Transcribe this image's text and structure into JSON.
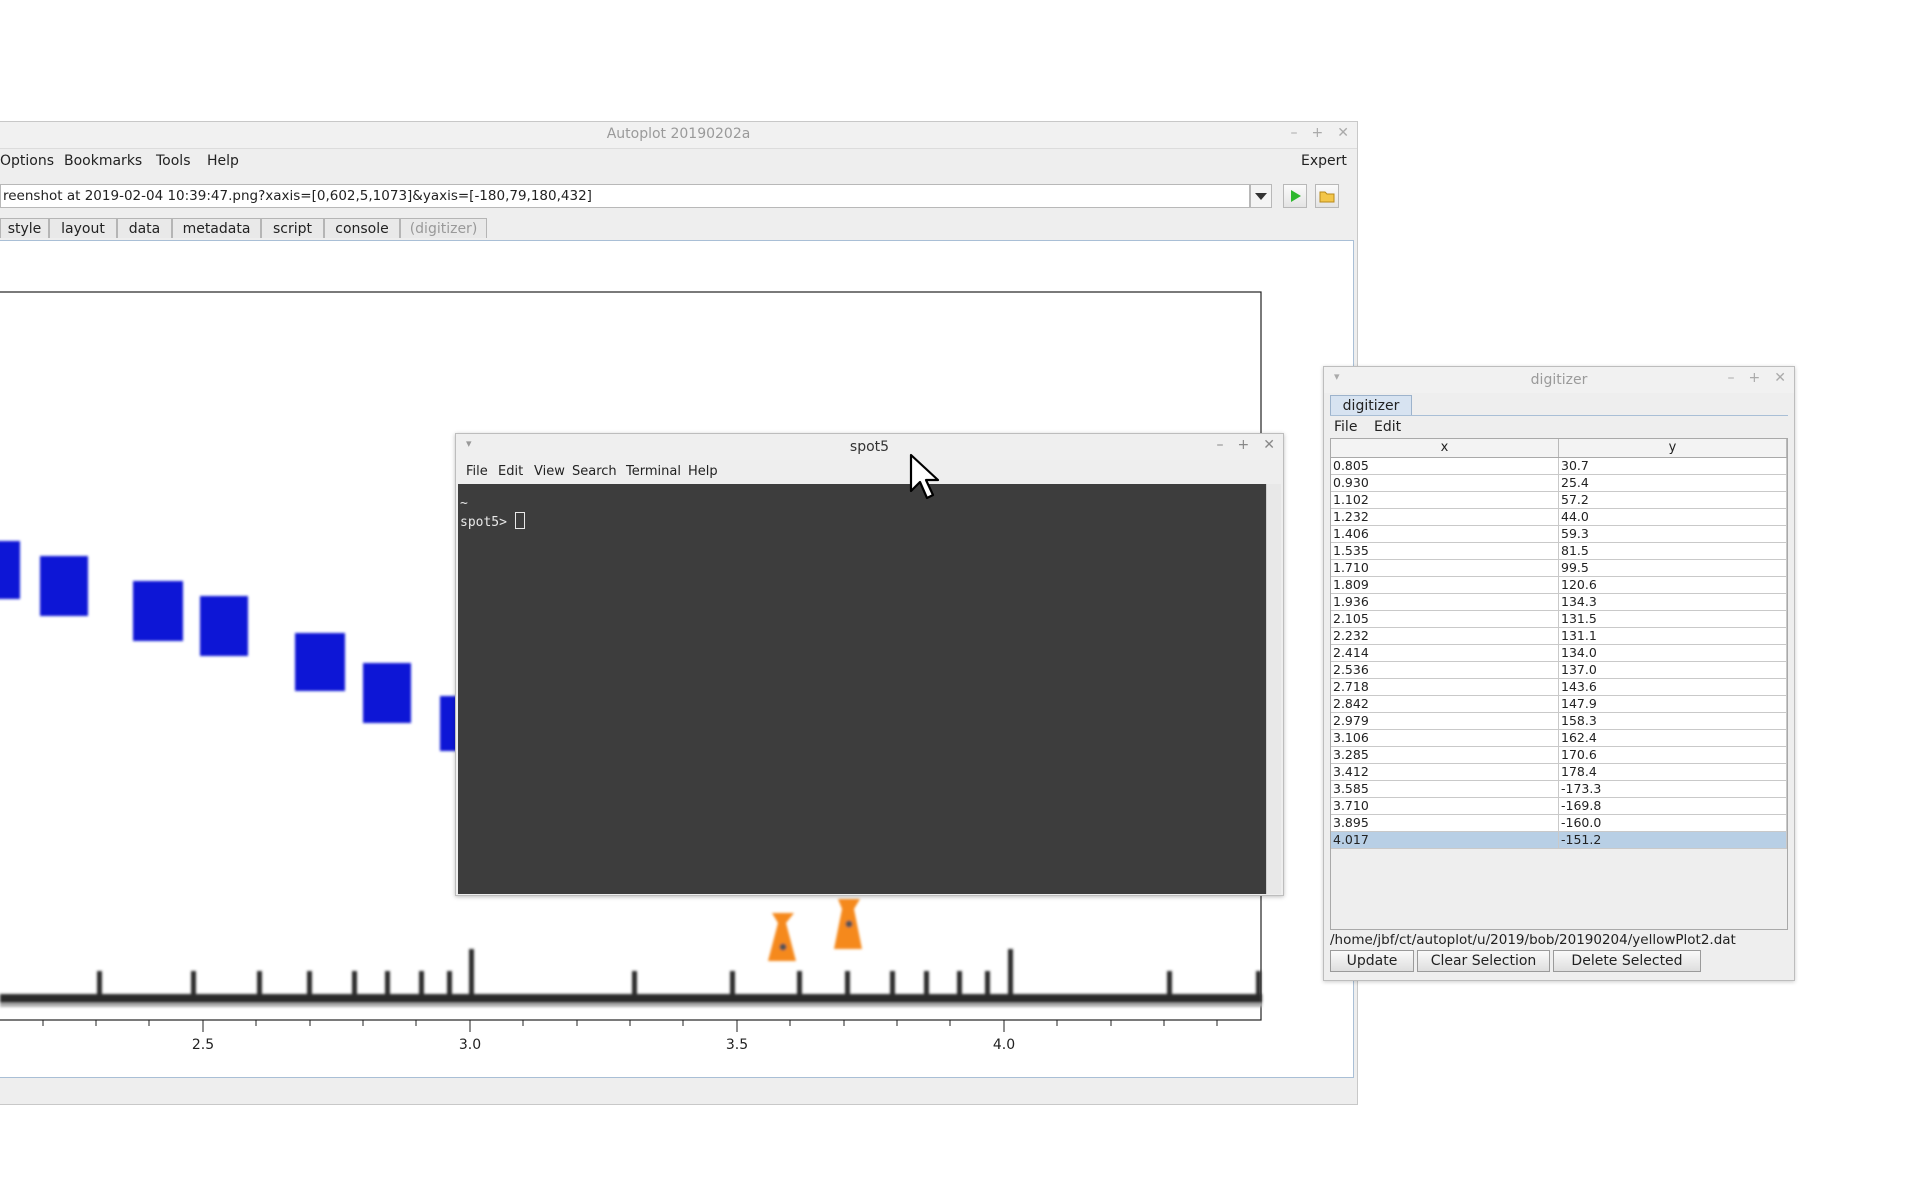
{
  "autoplot": {
    "title": "Autoplot 20190202a",
    "menu": [
      "Options",
      "Bookmarks",
      "Tools",
      "Help"
    ],
    "expert_label": "Expert",
    "url": "reenshot at 2019-02-04 10:39:47.png?xaxis=[0,602,5,1073]&yaxis=[-180,79,180,432]",
    "tabs": [
      "style",
      "layout",
      "data",
      "metadata",
      "script",
      "console",
      "(digitizer)"
    ],
    "xaxis_ticks": [
      "2.5",
      "3.0",
      "3.5",
      "4.0"
    ]
  },
  "terminal": {
    "title": "spot5",
    "menu": [
      "File",
      "Edit",
      "View",
      "Search",
      "Terminal",
      "Help"
    ],
    "line1": "~",
    "prompt": "spot5> "
  },
  "digitizer": {
    "title": "digitizer",
    "tab_label": "digitizer",
    "menu": [
      "File",
      "Edit"
    ],
    "columns": [
      "x",
      "y"
    ],
    "rows": [
      [
        "0.805",
        "30.7"
      ],
      [
        "0.930",
        "25.4"
      ],
      [
        "1.102",
        "57.2"
      ],
      [
        "1.232",
        "44.0"
      ],
      [
        "1.406",
        "59.3"
      ],
      [
        "1.535",
        "81.5"
      ],
      [
        "1.710",
        "99.5"
      ],
      [
        "1.809",
        "120.6"
      ],
      [
        "1.936",
        "134.3"
      ],
      [
        "2.105",
        "131.5"
      ],
      [
        "2.232",
        "131.1"
      ],
      [
        "2.414",
        "134.0"
      ],
      [
        "2.536",
        "137.0"
      ],
      [
        "2.718",
        "143.6"
      ],
      [
        "2.842",
        "147.9"
      ],
      [
        "2.979",
        "158.3"
      ],
      [
        "3.106",
        "162.4"
      ],
      [
        "3.285",
        "170.6"
      ],
      [
        "3.412",
        "178.4"
      ],
      [
        "3.585",
        "-173.3"
      ],
      [
        "3.710",
        "-169.8"
      ],
      [
        "3.895",
        "-160.0"
      ],
      [
        "4.017",
        "-151.2"
      ]
    ],
    "selected_row": 22,
    "file_path": "/home/jbf/ct/autoplot/u/2019/bob/20190204/yellowPlot2.dat",
    "buttons": [
      "Update",
      "Clear Selection",
      "Delete Selected"
    ]
  },
  "colors": {
    "marker_blue": "#0a14d6",
    "marker_orange": "#f5891f",
    "terminal_bg": "#3d3d3d",
    "selection": "#b8cfe5"
  }
}
